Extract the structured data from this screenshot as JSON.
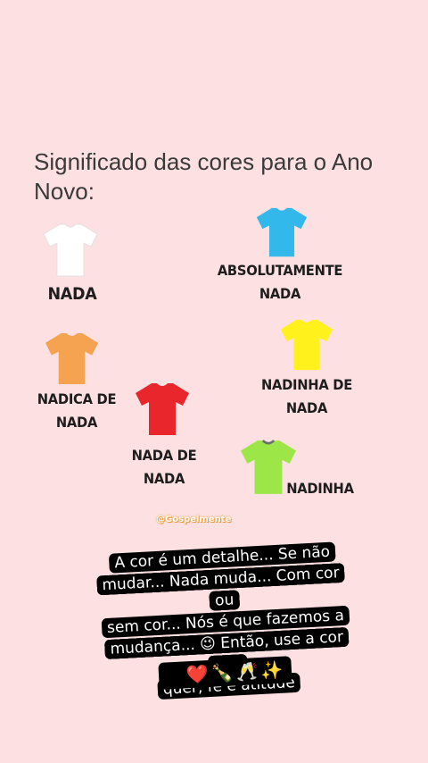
{
  "title": "Significado das cores para o Ano Novo:",
  "shirts": [
    {
      "id": "white",
      "color": "#ffffff",
      "label_lines": [
        "NADA"
      ]
    },
    {
      "id": "blue",
      "color": "#33b8ec",
      "label_lines": [
        "ABSOLUTAMENTE",
        "NADA"
      ]
    },
    {
      "id": "orange",
      "color": "#f5a350",
      "label_lines": [
        "NADICA DE",
        "NADA"
      ]
    },
    {
      "id": "yellow",
      "color": "#fff21c",
      "label_lines": [
        "NADINHA DE",
        "NADA"
      ]
    },
    {
      "id": "red",
      "color": "#e8262c",
      "label_lines": [
        "NADA DE",
        "NADA"
      ]
    },
    {
      "id": "green",
      "color": "#9de647",
      "label_lines": [
        "NADINHA"
      ]
    }
  ],
  "handle": "@Gospelmente",
  "caption": {
    "lines": [
      "A cor é um detalhe... Se não",
      "mudar... Nada muda... Com cor ou",
      "sem cor... Nós é que fazemos a",
      "mudança... 😉 Então, use a cor que",
      "quer, fé e atitude"
    ],
    "emojis": [
      "😁",
      "❤️",
      "🍾",
      "🥂",
      "✨"
    ]
  }
}
